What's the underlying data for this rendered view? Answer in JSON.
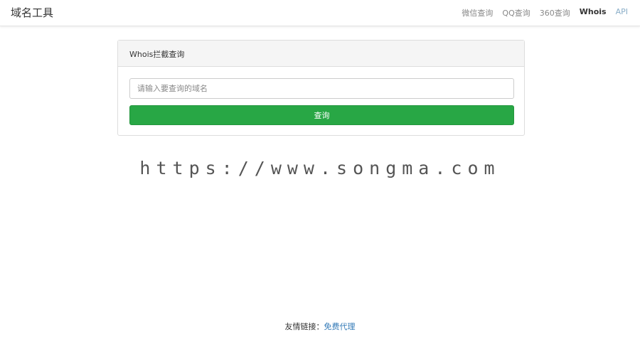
{
  "navbar": {
    "brand": "域名工具",
    "links": [
      "微信查询",
      "QQ查询",
      "360查询",
      "Whois",
      "API"
    ],
    "active": "Whois"
  },
  "panel": {
    "heading": "Whois拦截查询",
    "input_placeholder": "请输入要查询的域名",
    "input_value": "",
    "button_label": "查询"
  },
  "watermark": "https://www.songma.com",
  "footer": {
    "label": "友情链接：",
    "link": "免费代理"
  },
  "colors": {
    "button": "#28a745",
    "link": "#337ab7"
  }
}
